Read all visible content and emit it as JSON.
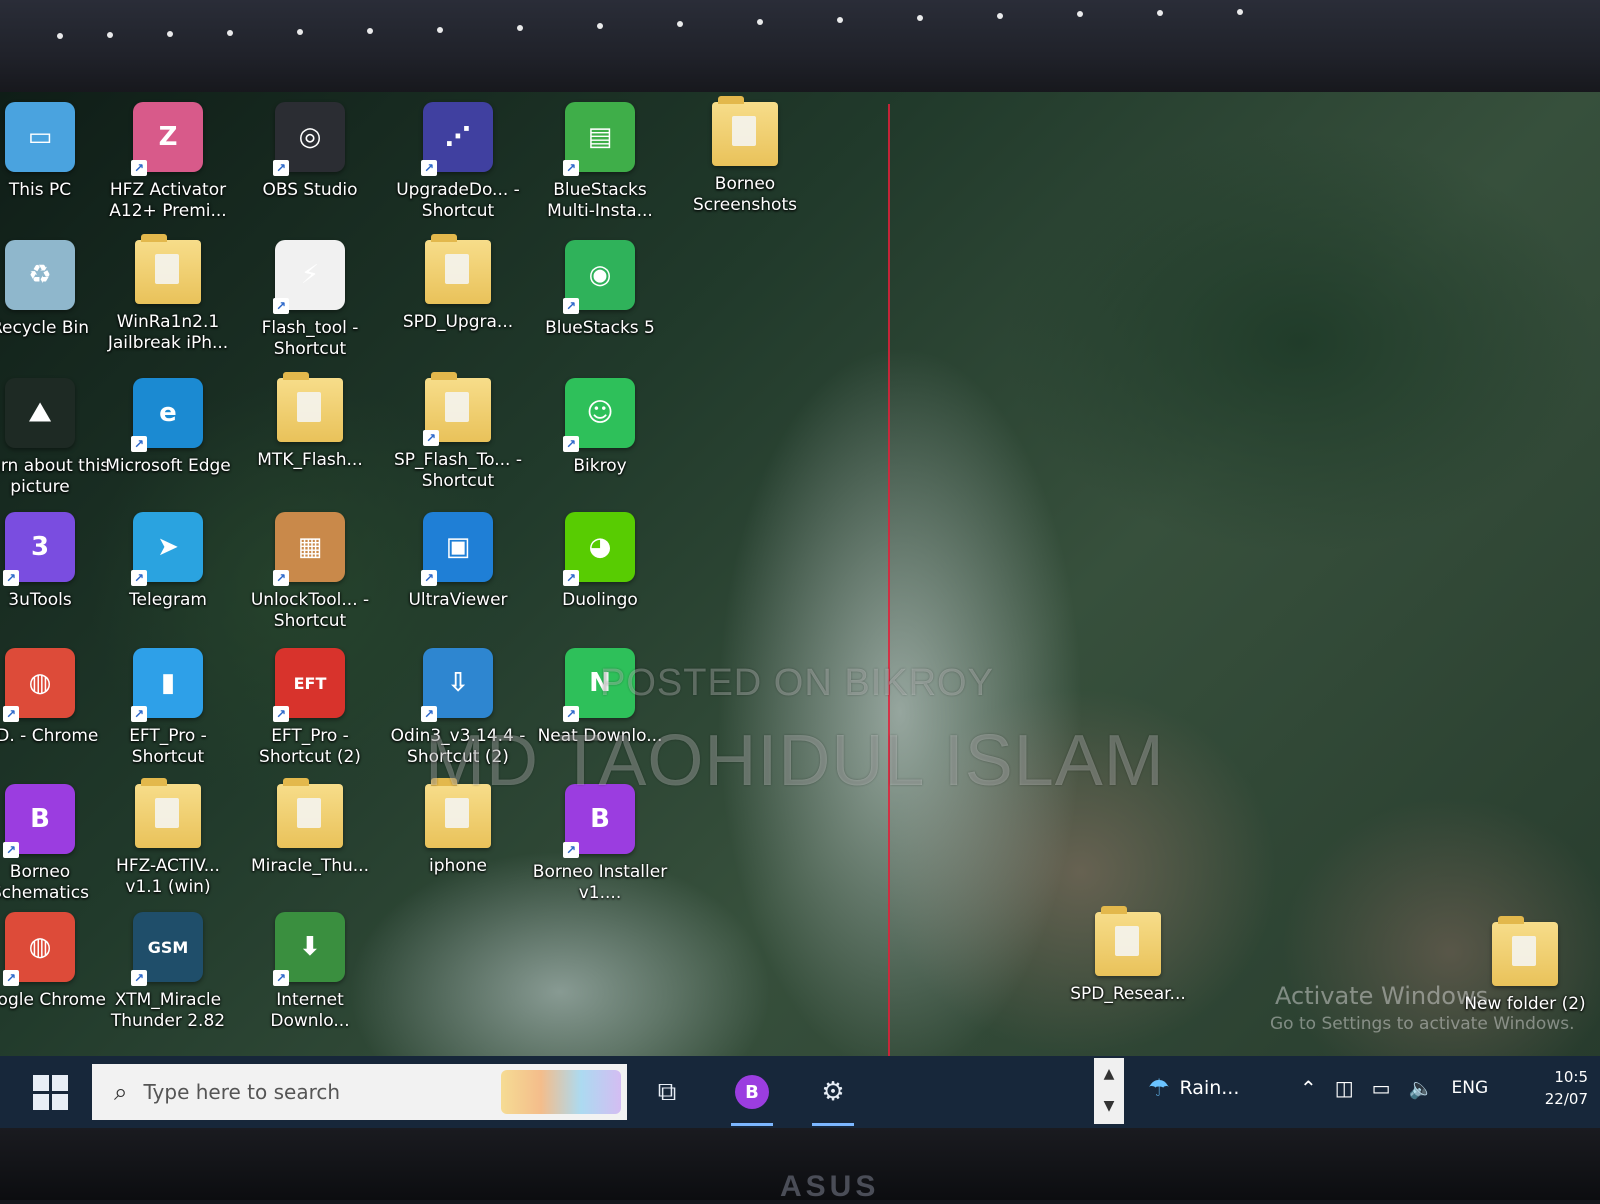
{
  "brand": "ASUS",
  "desktop": {
    "icons": [
      {
        "label": "This PC",
        "icon": "this-pc-icon",
        "color": "#4aa3df",
        "glyph": "▭",
        "shortcut": false
      },
      {
        "label": "HFZ Activator A12+ Premi...",
        "icon": "hfz-activator-icon",
        "color": "#d85a8a",
        "glyph": "Z",
        "shortcut": true
      },
      {
        "label": "OBS Studio",
        "icon": "obs-studio-icon",
        "color": "#2b2d33",
        "glyph": "◎",
        "shortcut": true
      },
      {
        "label": "UpgradeDo... - Shortcut",
        "icon": "upgrade-download-icon",
        "color": "#4040a0",
        "glyph": "⋰",
        "shortcut": true
      },
      {
        "label": "BlueStacks Multi-Insta...",
        "icon": "bluestacks-multi-instance-icon",
        "color": "#3fae49",
        "glyph": "▤",
        "shortcut": true
      },
      {
        "label": "Borneo Screenshots",
        "icon": "folder-icon",
        "color": "#e9c25a",
        "glyph": "",
        "shortcut": false
      },
      {
        "label": "Recycle Bin",
        "icon": "recycle-bin-icon",
        "color": "#8fb7cc",
        "glyph": "♻",
        "shortcut": false
      },
      {
        "label": "WinRa1n2.1 Jailbreak iPh...",
        "icon": "folder-icon",
        "color": "#e9c25a",
        "glyph": "",
        "shortcut": false
      },
      {
        "label": "Flash_tool - Shortcut",
        "icon": "flash-tool-icon",
        "color": "#f1f1f1",
        "glyph": "⚡",
        "shortcut": true
      },
      {
        "label": "SPD_Upgra...",
        "icon": "folder-icon",
        "color": "#e9c25a",
        "glyph": "",
        "shortcut": false
      },
      {
        "label": "BlueStacks 5",
        "icon": "bluestacks-5-icon",
        "color": "#2fb25a",
        "glyph": "◉",
        "shortcut": true
      },
      {
        "label": "Learn about this picture",
        "icon": "learn-about-picture-icon",
        "color": "#1e2a24",
        "glyph": "⛰",
        "shortcut": false
      },
      {
        "label": "Microsoft Edge",
        "icon": "microsoft-edge-icon",
        "color": "#1b8ad2",
        "glyph": "e",
        "shortcut": true
      },
      {
        "label": "MTK_Flash...",
        "icon": "folder-icon",
        "color": "#e9c25a",
        "glyph": "",
        "shortcut": false
      },
      {
        "label": "SP_Flash_To... - Shortcut",
        "icon": "folder-icon",
        "color": "#e9c25a",
        "glyph": "",
        "shortcut": true
      },
      {
        "label": "Bikroy",
        "icon": "bikroy-icon",
        "color": "#2ec05a",
        "glyph": "☺",
        "shortcut": true
      },
      {
        "label": "3uTools",
        "icon": "3utools-icon",
        "color": "#7a4de0",
        "glyph": "3",
        "shortcut": true
      },
      {
        "label": "Telegram",
        "icon": "telegram-icon",
        "color": "#2aa3e0",
        "glyph": "➤",
        "shortcut": true
      },
      {
        "label": "UnlockTool... - Shortcut",
        "icon": "unlocktool-icon",
        "color": "#c9894a",
        "glyph": "▦",
        "shortcut": true
      },
      {
        "label": "UltraViewer",
        "icon": "ultraviewer-icon",
        "color": "#1f7fd6",
        "glyph": "▣",
        "shortcut": true
      },
      {
        "label": "Duolingo",
        "icon": "duolingo-icon",
        "color": "#58cc02",
        "glyph": "◕",
        "shortcut": true
      },
      {
        "label": "MD. - Chrome",
        "icon": "chrome-profile-icon",
        "color": "#dd4b39",
        "glyph": "◍",
        "shortcut": true
      },
      {
        "label": "EFT_Pro - Shortcut",
        "icon": "eft-pro-icon",
        "color": "#2ea0e8",
        "glyph": "▮",
        "shortcut": true
      },
      {
        "label": "EFT_Pro - Shortcut (2)",
        "icon": "eft-pro-icon",
        "color": "#d8332c",
        "glyph": "EFT",
        "shortcut": true
      },
      {
        "label": "Odin3_v3.14.4 - Shortcut (2)",
        "icon": "odin3-icon",
        "color": "#2e86d0",
        "glyph": "⇩",
        "shortcut": true
      },
      {
        "label": "Neat Downlo...",
        "icon": "neat-download-icon",
        "color": "#2ec05a",
        "glyph": "N",
        "shortcut": true
      },
      {
        "label": "Borneo Schematics",
        "icon": "borneo-schematics-icon",
        "color": "#9b3de0",
        "glyph": "B",
        "shortcut": true
      },
      {
        "label": "HFZ-ACTIV... v1.1 (win)",
        "icon": "folder-icon",
        "color": "#e9c25a",
        "glyph": "",
        "shortcut": false
      },
      {
        "label": "Miracle_Thu...",
        "icon": "folder-icon",
        "color": "#e9c25a",
        "glyph": "",
        "shortcut": false
      },
      {
        "label": "iphone",
        "icon": "folder-icon",
        "color": "#e9c25a",
        "glyph": "",
        "shortcut": false
      },
      {
        "label": "Borneo Installer v1....",
        "icon": "borneo-installer-icon",
        "color": "#9b3de0",
        "glyph": "B",
        "shortcut": true
      },
      {
        "label": "Google Chrome",
        "icon": "google-chrome-icon",
        "color": "#dd4b39",
        "glyph": "◍",
        "shortcut": true
      },
      {
        "label": "XTM_Miracle Thunder 2.82",
        "icon": "xtm-miracle-icon",
        "color": "#1f4e6a",
        "glyph": "GSM",
        "shortcut": true
      },
      {
        "label": "Internet Downlo...",
        "icon": "internet-download-manager-icon",
        "color": "#3a8f3f",
        "glyph": "⬇",
        "shortcut": true
      },
      {
        "label": "SPD_Resear...",
        "icon": "folder-icon",
        "color": "#e9c25a",
        "glyph": "",
        "shortcut": false
      },
      {
        "label": "New folder (2)",
        "icon": "folder-icon",
        "color": "#e9c25a",
        "glyph": "",
        "shortcut": false
      }
    ]
  },
  "watermark": {
    "line1": "POSTED ON BIKROY",
    "line2": "MD TAOHIDUL ISLAM"
  },
  "activation": {
    "title": "Activate Windows",
    "subtitle": "Go to Settings to activate Windows."
  },
  "taskbar": {
    "search_placeholder": "Type here to search",
    "weather": "Rain...",
    "language": "ENG",
    "time": "10:5",
    "date": "22/07"
  }
}
